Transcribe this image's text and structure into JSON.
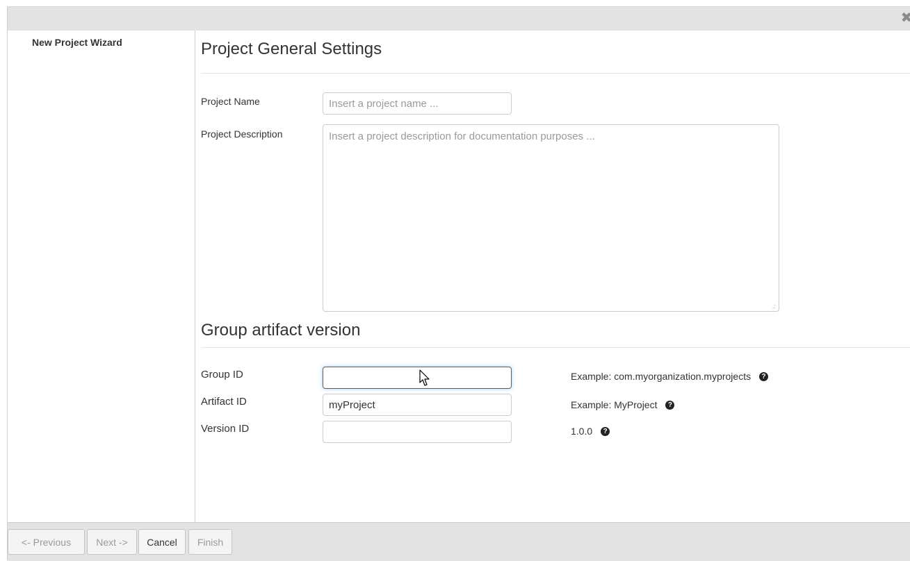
{
  "dialog": {
    "close_icon": "close-icon"
  },
  "sidebar": {
    "title": "New Project Wizard"
  },
  "general": {
    "title": "Project General Settings",
    "project_name_label": "Project Name",
    "project_name_placeholder": "Insert a project name ...",
    "project_name_value": "",
    "project_description_label": "Project Description",
    "project_description_placeholder": "Insert a project description for documentation purposes ...",
    "project_description_value": ""
  },
  "gav": {
    "title": "Group artifact version",
    "group_id_label": "Group ID",
    "group_id_value": "",
    "group_id_hint": "Example: com.myorganization.myprojects",
    "artifact_id_label": "Artifact ID",
    "artifact_id_value": "myProject",
    "artifact_id_hint": "Example: MyProject",
    "version_id_label": "Version ID",
    "version_id_value": "",
    "version_id_hint": "1.0.0",
    "help_icon": "question-circle-icon"
  },
  "footer": {
    "previous_label": "<- Previous",
    "next_label": "Next ->",
    "cancel_label": "Cancel",
    "finish_label": "Finish"
  }
}
